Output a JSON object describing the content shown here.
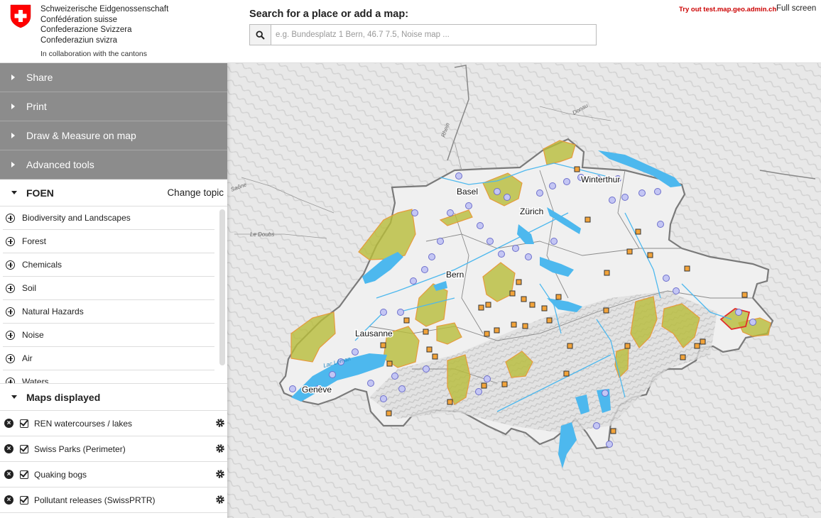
{
  "header": {
    "confederation": [
      "Schweizerische Eidgenossenschaft",
      "Confédération suisse",
      "Confederazione Svizzera",
      "Confederaziun svizra"
    ],
    "collaboration": "In collaboration with the cantons",
    "search_label": "Search for a place or add a map:",
    "search_placeholder": "e.g. Bundesplatz 1 Bern, 46.7 7.5, Noise map ...",
    "search_value": "",
    "tryout": "Try out test.map.geo.admin.ch",
    "fullscreen": "Full screen",
    "brand_color": "#ff0000"
  },
  "tools": [
    {
      "label": "Share"
    },
    {
      "label": "Print"
    },
    {
      "label": "Draw & Measure on map"
    },
    {
      "label": "Advanced tools"
    }
  ],
  "topic": {
    "title": "FOEN",
    "change_label": "Change topic",
    "catalog": [
      "Biodiversity and Landscapes",
      "Forest",
      "Chemicals",
      "Soil",
      "Natural Hazards",
      "Noise",
      "Air",
      "Waters"
    ]
  },
  "maps_displayed": {
    "title": "Maps displayed",
    "layers": [
      "REN watercourses / lakes",
      "Swiss Parks (Perimeter)",
      "Quaking bogs",
      "Pollutant releases (SwissPRTR)"
    ]
  },
  "map": {
    "places": [
      "Basel",
      "Zürich",
      "Winterthur",
      "Bern",
      "Lausanne",
      "Genève"
    ],
    "rivers": [
      "Rhein",
      "Donau",
      "Le Doubs",
      "Lac Léman",
      "Saône"
    ],
    "colors": {
      "lake": "#4db8ee",
      "park": "#b8bd3a",
      "bog_marker": "#7d7fd6",
      "pollutant_marker": "#f2a33a",
      "border": "#7a7a7a"
    }
  }
}
